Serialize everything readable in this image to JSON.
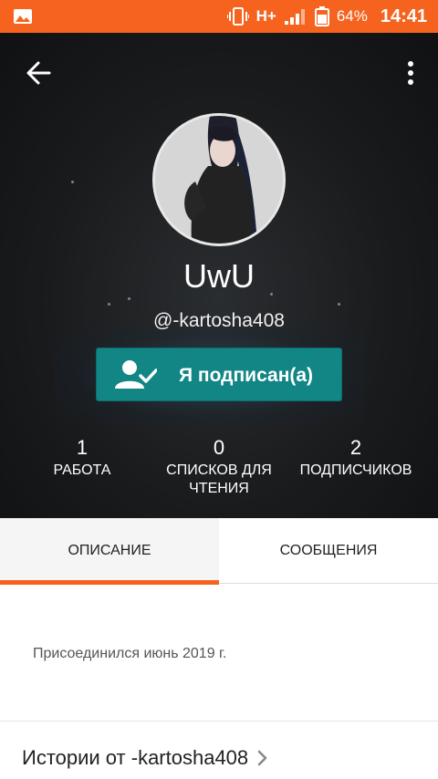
{
  "status_bar": {
    "network": "H+",
    "battery": "64%",
    "time": "14:41"
  },
  "profile": {
    "display_name": "UwU",
    "username": "@-kartosha408",
    "follow_label": "Я подписан(а)"
  },
  "stats": [
    {
      "value": "1",
      "label": "РАБОТА"
    },
    {
      "value": "0",
      "label": "СПИСКОВ ДЛЯ ЧТЕНИЯ"
    },
    {
      "value": "2",
      "label": "ПОДПИСЧИКОВ"
    }
  ],
  "tabs": [
    {
      "label": "ОПИСАНИЕ",
      "active": true
    },
    {
      "label": "СООБЩЕНИЯ",
      "active": false
    }
  ],
  "about": {
    "joined": "Присоединился июнь 2019 г."
  },
  "stories": {
    "title": "Истории от -kartosha408"
  },
  "colors": {
    "accent": "#f5631f",
    "follow_button": "#128585",
    "header_bg": "#1a1b1d"
  },
  "icons": [
    "gallery-icon",
    "vibrate-icon",
    "signal-icon",
    "battery-icon",
    "back-arrow-icon",
    "more-vert-icon",
    "person-check-icon",
    "chevron-right-icon"
  ]
}
